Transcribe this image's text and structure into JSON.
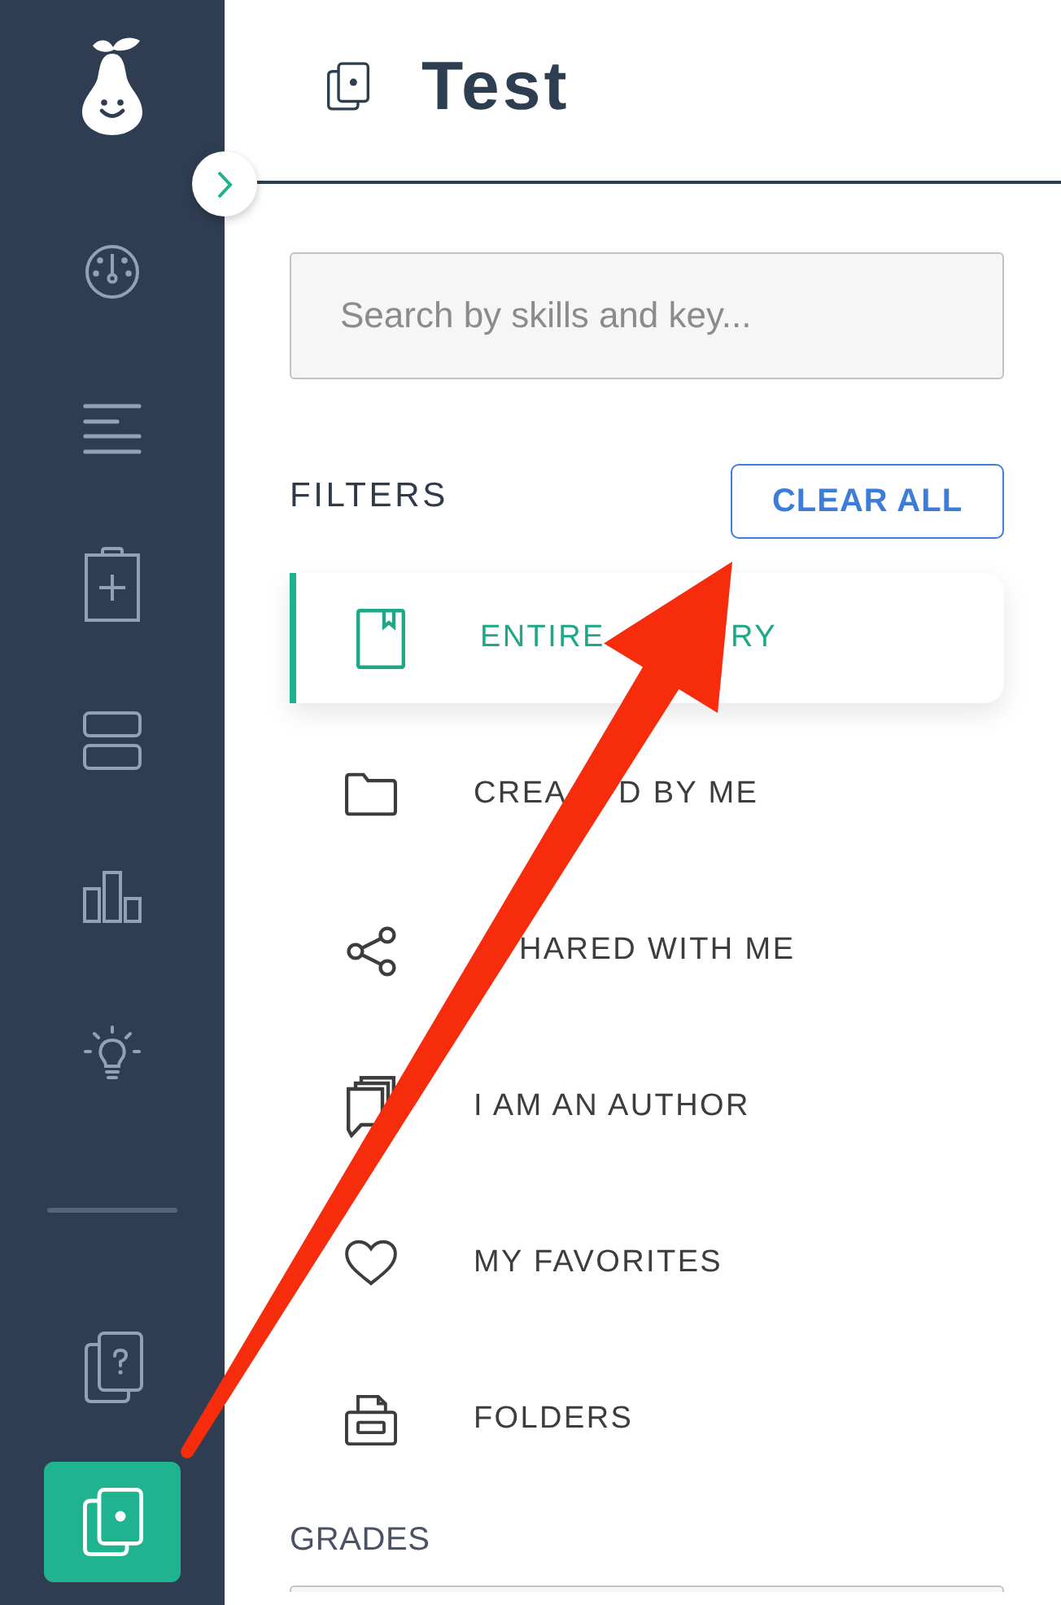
{
  "sidebar": {
    "expanded": false,
    "items": [
      {
        "kind": "gauge",
        "selected": false
      },
      {
        "kind": "lines",
        "selected": false
      },
      {
        "kind": "clipboard",
        "selected": false
      },
      {
        "kind": "rows",
        "selected": false
      },
      {
        "kind": "chart",
        "selected": false
      },
      {
        "kind": "bulb",
        "selected": false
      }
    ],
    "bottom_items": [
      {
        "kind": "question",
        "selected": false
      },
      {
        "kind": "cards",
        "selected": true
      }
    ]
  },
  "header": {
    "title": "Test"
  },
  "search": {
    "placeholder": "Search by skills and key..."
  },
  "filters": {
    "title": "FILTERS",
    "clear_button": "CLEAR ALL",
    "items": [
      {
        "kind": "library",
        "selected": true,
        "start_hidden": false,
        "text_parts": [
          "ENTIRE",
          "RY"
        ]
      },
      {
        "kind": "created",
        "selected": false,
        "start_hidden": false,
        "text_parts": [
          "CREA",
          "D BY ME"
        ]
      },
      {
        "kind": "shared",
        "selected": false,
        "start_hidden": true,
        "text_parts": [
          "HARED WITH ME"
        ]
      },
      {
        "kind": "author",
        "selected": false,
        "start_hidden": false,
        "text_parts": [
          "I AM AN AUTHOR"
        ]
      },
      {
        "kind": "favorites",
        "selected": false,
        "start_hidden": false,
        "text_parts": [
          "MY FAVORITES"
        ]
      },
      {
        "kind": "folders",
        "selected": false,
        "start_hidden": false,
        "text_parts": [
          "FOLDERS"
        ]
      }
    ]
  },
  "grades": {
    "title": "GRADES"
  },
  "annotation": {
    "kind": "arrow"
  }
}
